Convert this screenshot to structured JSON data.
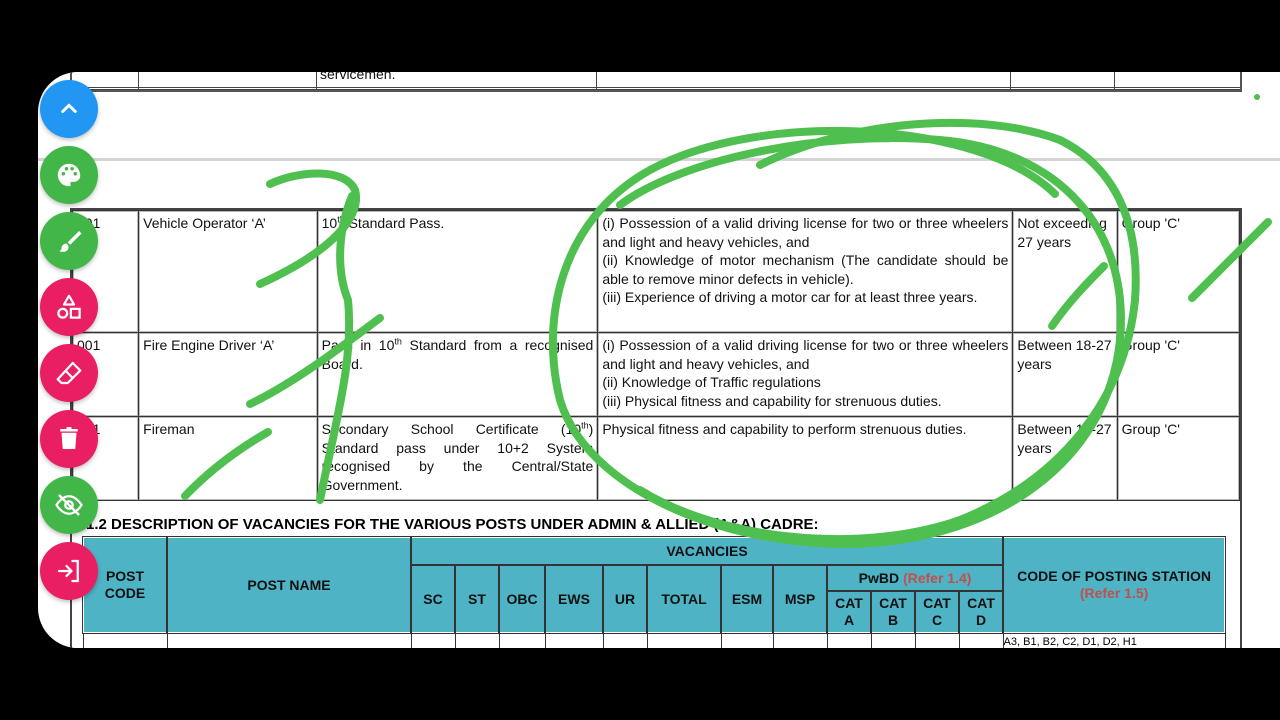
{
  "top_row": {
    "text": "servicemen."
  },
  "eligibility_rows": [
    {
      "code": "001",
      "post": "Vehicle Operator ‘A’",
      "edu_pre": "10",
      "edu_sup": "th",
      "edu_post": " Standard Pass.",
      "other": [
        "(i) Possession of a valid driving license for two or three wheelers and light and heavy vehicles, and",
        "(ii) Knowledge of motor mechanism (The candidate should be able to remove minor defects in vehicle).",
        "(iii) Experience of driving a motor car for at least three years."
      ],
      "age": "Not exceeding 27 years",
      "group": "Group 'C'"
    },
    {
      "code": "001",
      "post": "Fire Engine Driver ‘A’",
      "edu_pre": "Pass in 10",
      "edu_sup": "th",
      "edu_post": " Standard from a recognised Board.",
      "other": [
        "(i) Possession of a valid driving license for two or three wheelers and light and heavy vehicles, and",
        "(ii) Knowledge of Traffic regulations",
        "(iii) Physical fitness and capability for strenuous duties."
      ],
      "age": "Between 18-27 years",
      "group": "Group 'C'"
    },
    {
      "code": "001",
      "post": "Fireman",
      "edu_pre": "Secondary School Certificate (10",
      "edu_sup": "th",
      "edu_post": ") Standard pass under 10+2 System recognised by the Central/State Government.",
      "other": [
        "Physical fitness and capability to perform strenuous duties."
      ],
      "age": "Between 18-27 years",
      "group": "Group 'C'"
    }
  ],
  "section_heading": "1.2 DESCRIPTION OF VACANCIES FOR THE VARIOUS POSTS UNDER ADMIN & ALLIED (A&A) CADRE:",
  "vacancy_header": {
    "post_code": "POST CODE",
    "post_name": "POST NAME",
    "vacancies": "VACANCIES",
    "columns": [
      "SC",
      "ST",
      "OBC",
      "EWS",
      "UR",
      "TOTAL",
      "ESM",
      "MSP"
    ],
    "pwbd": "PwBD",
    "pwbd_ref": "(Refer 1.4)",
    "pwbd_cats": [
      "CAT A",
      "CAT B",
      "CAT C",
      "CAT D"
    ],
    "posting": "CODE OF POSTING STATION",
    "posting_ref": "(Refer 1.5)",
    "partial_row_text": "A3, B1, B2, C2, D1, D2, H1"
  },
  "toolbar": [
    {
      "name": "collapse-toolbar-button",
      "icon": "chevron-up-icon",
      "color": "#2196f3"
    },
    {
      "name": "color-palette-button",
      "icon": "palette-icon",
      "color": "#43b649"
    },
    {
      "name": "pen-tool-button",
      "icon": "brush-icon",
      "color": "#43b649"
    },
    {
      "name": "shapes-tool-button",
      "icon": "shapes-icon",
      "color": "#e91e63"
    },
    {
      "name": "eraser-tool-button",
      "icon": "eraser-icon",
      "color": "#e91e63"
    },
    {
      "name": "clear-all-button",
      "icon": "trash-icon",
      "color": "#e91e63"
    },
    {
      "name": "hide-drawings-button",
      "icon": "eye-off-icon",
      "color": "#43b649"
    },
    {
      "name": "exit-drawing-button",
      "icon": "exit-icon",
      "color": "#e91e63"
    }
  ],
  "colors": {
    "ink": "#4fc04f",
    "table_header": "#4fb3c6",
    "ref_text": "#c0504d"
  }
}
